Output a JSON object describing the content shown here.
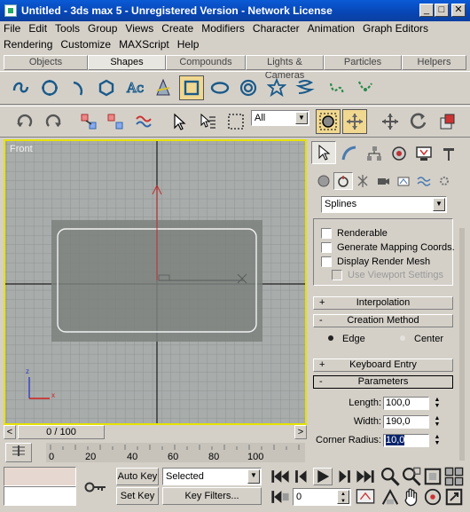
{
  "window": {
    "title": "Untitled - 3ds max 5 - Unregistered Version - Network License",
    "min_label": "_",
    "max_label": "□",
    "close_label": "✕"
  },
  "menu": {
    "row1": [
      "File",
      "Edit",
      "Tools",
      "Group",
      "Views",
      "Create",
      "Modifiers",
      "Character",
      "Animation",
      "Graph Editors"
    ],
    "row2": [
      "Rendering",
      "Customize",
      "MAXScript",
      "Help"
    ]
  },
  "tabs": [
    "Objects",
    "Shapes",
    "Compounds",
    "Lights & Cameras",
    "Particles",
    "Helpers"
  ],
  "active_tab": "Shapes",
  "shape_tools": [
    "line-icon",
    "circle-icon",
    "arc-icon",
    "ngon-icon",
    "text-icon",
    "section-icon",
    "rectangle-icon",
    "ellipse-icon",
    "donut-icon",
    "star-icon",
    "helix-icon",
    "extended-spline-icon-1",
    "extended-spline-icon-2"
  ],
  "main_toolbar": {
    "selection_filter": "All"
  },
  "viewport": {
    "label": "Front",
    "axis_x": "x",
    "axis_z": "z"
  },
  "command_panel": {
    "category_dropdown": "Splines",
    "checkboxes": [
      {
        "label": "Renderable",
        "checked": false,
        "enabled": true
      },
      {
        "label": "Generate Mapping Coords.",
        "checked": false,
        "enabled": true
      },
      {
        "label": "Display Render Mesh",
        "checked": false,
        "enabled": true
      },
      {
        "label": "Use Viewport Settings",
        "checked": false,
        "enabled": false
      }
    ],
    "rollouts": {
      "interpolation": {
        "sign": "+",
        "label": "Interpolation"
      },
      "creation_method": {
        "sign": "-",
        "label": "Creation Method"
      },
      "keyboard_entry": {
        "sign": "+",
        "label": "Keyboard Entry"
      },
      "parameters": {
        "sign": "-",
        "label": "Parameters"
      }
    },
    "creation_options": [
      {
        "label": "Edge",
        "selected": true
      },
      {
        "label": "Center",
        "selected": false
      }
    ],
    "parameters": [
      {
        "label": "Length:",
        "value": "100,0"
      },
      {
        "label": "Width:",
        "value": "190,0"
      },
      {
        "label": "Corner Radius:",
        "value": "10,0"
      }
    ]
  },
  "timeline": {
    "frame_slider": "0 / 100",
    "prev_label": "<",
    "next_label": ">",
    "ticks": [
      "0",
      "20",
      "40",
      "60",
      "80",
      "100"
    ]
  },
  "animation_controls": {
    "auto_key": "Auto Key",
    "set_key": "Set Key",
    "key_mode_dropdown": "Selected",
    "key_filters": "Key Filters...",
    "current_frame": "0"
  },
  "colors": {
    "viewport_bg": "#a8acab",
    "viewport_border": "#e6e200",
    "title_bar": "#0a5ad6",
    "selected_tool": "#f0d890"
  }
}
